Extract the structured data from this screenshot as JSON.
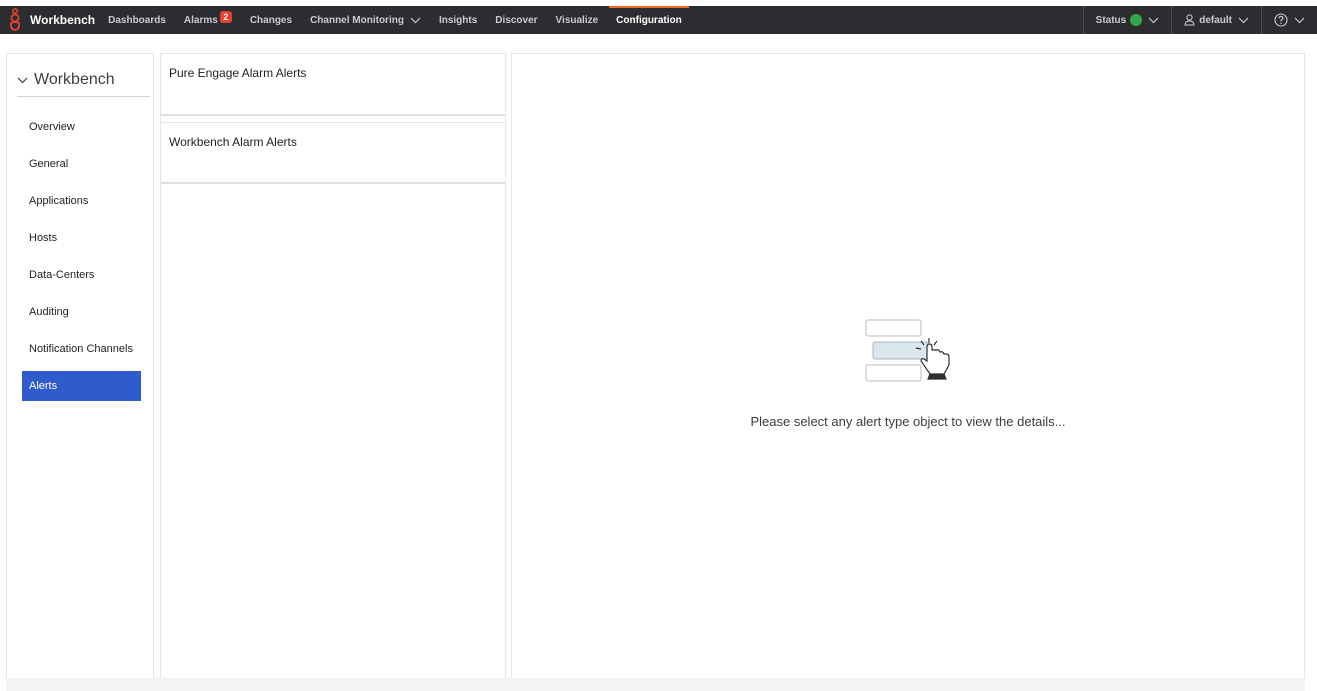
{
  "nav": {
    "brand": "Workbench",
    "items": [
      {
        "label": "Dashboards"
      },
      {
        "label": "Alarms",
        "badge": "2"
      },
      {
        "label": "Changes"
      },
      {
        "label": "Channel Monitoring"
      },
      {
        "label": "Insights"
      },
      {
        "label": "Discover"
      },
      {
        "label": "Visualize"
      },
      {
        "label": "Configuration",
        "active": true
      }
    ],
    "status_label": "Status",
    "user_label": "default"
  },
  "sidebar": {
    "title": "Workbench",
    "items": [
      {
        "label": "Overview"
      },
      {
        "label": "General"
      },
      {
        "label": "Applications"
      },
      {
        "label": "Hosts"
      },
      {
        "label": "Data-Centers"
      },
      {
        "label": "Auditing"
      },
      {
        "label": "Notification Channels"
      },
      {
        "label": "Alerts",
        "active": true
      }
    ]
  },
  "alert_types": [
    {
      "label": "Pure Engage Alarm Alerts"
    },
    {
      "label": "Workbench Alarm Alerts"
    }
  ],
  "detail": {
    "empty_message": "Please select any alert type object to view the details..."
  },
  "colors": {
    "accent": "#f26b21",
    "selected": "#2f5bcc",
    "status_ok": "#2ea84a",
    "badge": "#e8412f",
    "topbar": "#2b2d31"
  }
}
